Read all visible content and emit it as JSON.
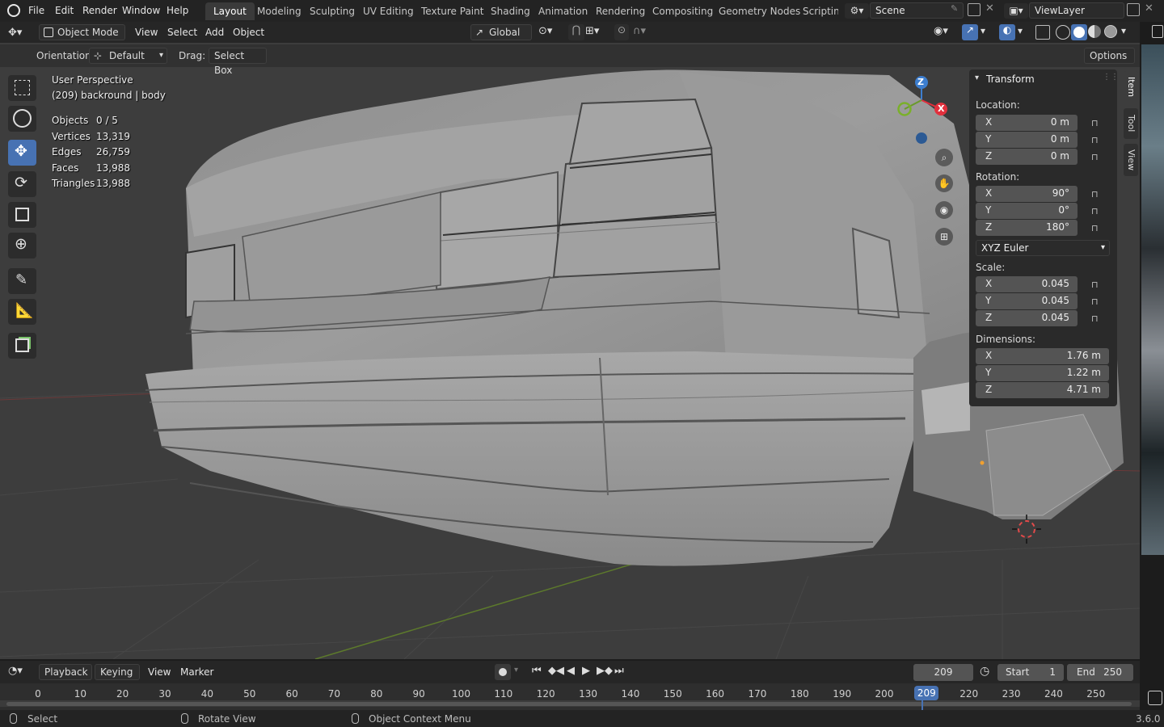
{
  "menubar": {
    "items": [
      "File",
      "Edit",
      "Render",
      "Window",
      "Help"
    ],
    "workspaces": [
      "Layout",
      "Modeling",
      "Sculpting",
      "UV Editing",
      "Texture Paint",
      "Shading",
      "Animation",
      "Rendering",
      "Compositing",
      "Geometry Nodes",
      "Scripting"
    ],
    "active_workspace": "Layout",
    "scene": "Scene",
    "view_layer": "ViewLayer"
  },
  "viewport_header": {
    "mode": "Object Mode",
    "menus": [
      "View",
      "Select",
      "Add",
      "Object"
    ],
    "transform_orientation": "Global"
  },
  "tool_settings": {
    "orientation_label": "Orientation:",
    "orientation_value": "Default",
    "drag_label": "Drag:",
    "drag_value": "Select Box",
    "options": "Options"
  },
  "overlay": {
    "perspective": "User Perspective",
    "object": "(209) backround | body",
    "stats": [
      {
        "label": "Objects",
        "value": "0 / 5"
      },
      {
        "label": "Vertices",
        "value": "13,319"
      },
      {
        "label": "Edges",
        "value": "26,759"
      },
      {
        "label": "Faces",
        "value": "13,988"
      },
      {
        "label": "Triangles",
        "value": "13,988"
      }
    ]
  },
  "npanel": {
    "title": "Transform",
    "location_label": "Location:",
    "location": [
      {
        "k": "X",
        "v": "0 m"
      },
      {
        "k": "Y",
        "v": "0 m"
      },
      {
        "k": "Z",
        "v": "0 m"
      }
    ],
    "rotation_label": "Rotation:",
    "rotation": [
      {
        "k": "X",
        "v": "90°"
      },
      {
        "k": "Y",
        "v": "0°"
      },
      {
        "k": "Z",
        "v": "180°"
      }
    ],
    "rotation_mode": "XYZ Euler",
    "scale_label": "Scale:",
    "scale": [
      {
        "k": "X",
        "v": "0.045"
      },
      {
        "k": "Y",
        "v": "0.045"
      },
      {
        "k": "Z",
        "v": "0.045"
      }
    ],
    "dimensions_label": "Dimensions:",
    "dimensions": [
      {
        "k": "X",
        "v": "1.76 m"
      },
      {
        "k": "Y",
        "v": "1.22 m"
      },
      {
        "k": "Z",
        "v": "4.71 m"
      }
    ],
    "tabs": [
      "Item",
      "Tool",
      "View"
    ]
  },
  "gizmo": {
    "z": "Z",
    "x": "X"
  },
  "timeline": {
    "menus": [
      "Playback",
      "Keying",
      "View",
      "Marker"
    ],
    "current_frame": "209",
    "start_label": "Start",
    "start": "1",
    "end_label": "End",
    "end": "250",
    "ticks": [
      "0",
      "10",
      "20",
      "30",
      "40",
      "50",
      "60",
      "70",
      "80",
      "90",
      "100",
      "110",
      "120",
      "130",
      "140",
      "150",
      "160",
      "170",
      "180",
      "190",
      "200",
      "209",
      "220",
      "230",
      "240",
      "250"
    ]
  },
  "statusbar": {
    "select": "Select",
    "rotate": "Rotate View",
    "context": "Object Context Menu",
    "version": "3.6.0"
  },
  "colors": {
    "accent": "#4772b3",
    "axis_x": "#e2303d",
    "axis_y": "#6a9a2a",
    "axis_z": "#3d7ecf"
  }
}
